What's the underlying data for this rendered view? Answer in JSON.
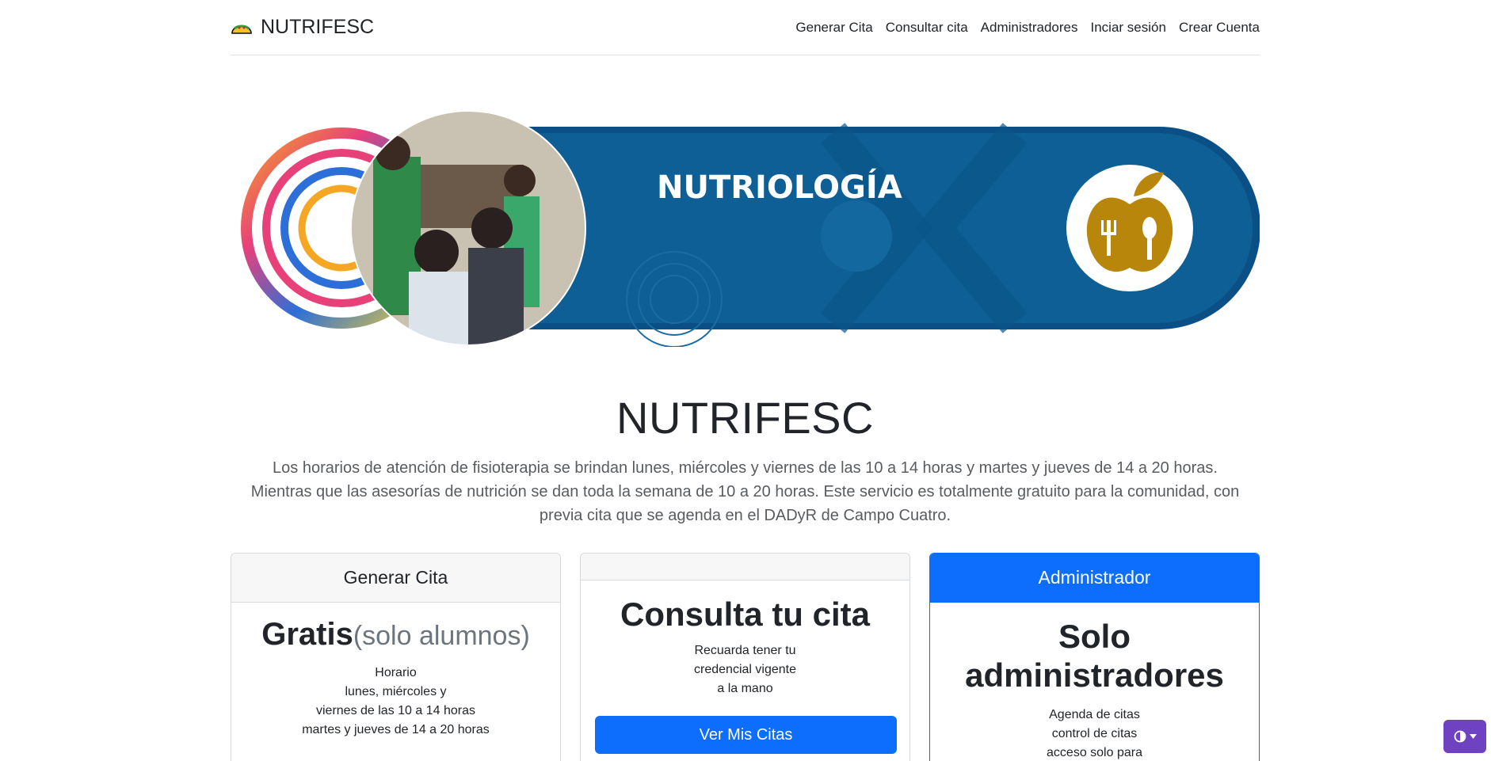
{
  "header": {
    "brand": "NUTRIFESC",
    "nav": [
      {
        "label": "Generar Cita"
      },
      {
        "label": "Consultar cita"
      },
      {
        "label": "Administradores"
      },
      {
        "label": "Inciar sesión"
      },
      {
        "label": "Crear Cuenta"
      }
    ]
  },
  "banner": {
    "title": "NUTRIOLOGÍA",
    "icon": "apple-fork-spoon-icon"
  },
  "hero": {
    "title": "NUTRIFESC",
    "lead": "Los horarios de atención de fisioterapia se brindan lunes, miércoles y viernes de las 10 a 14 horas y martes y jueves de 14 a 20 horas. Mientras que las asesorías de nutrición se dan toda la semana de 10 a 20 horas. Este servicio es totalmente gratuito para la comunidad, con previa cita que se agenda en el DADyR de Campo Cuatro."
  },
  "cards": {
    "generar": {
      "header": "Generar Cita",
      "price": "Gratis",
      "price_note": "(solo alumnos)",
      "lines": [
        "Horario",
        "lunes, miércoles y",
        "viernes de las 10 a 14 horas",
        "martes y jueves de 14 a 20 horas"
      ]
    },
    "consulta": {
      "title": "Consulta tu cita",
      "lines": [
        "Recuarda tener tu",
        "credencial vigente",
        "a la mano"
      ],
      "button": "Ver Mis Citas"
    },
    "admin": {
      "header": "Administrador",
      "title": "Solo administradores",
      "lines": [
        "Agenda de citas",
        "control de citas",
        "acceso solo para"
      ]
    }
  },
  "colors": {
    "primary": "#0d6efd",
    "banner_blue": "#0d5f95",
    "banner_gold": "#b8860b",
    "theme_toggle": "#6f42c1"
  }
}
